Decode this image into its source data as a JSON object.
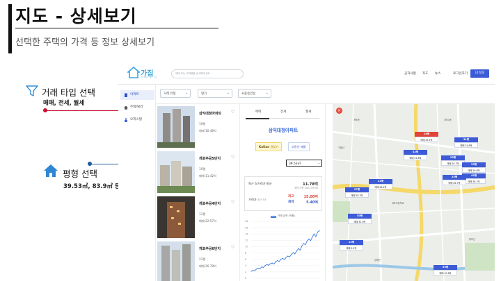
{
  "slide": {
    "title": "지도 - 상세보기",
    "subtitle": "선택한 주택의 가격 등 정보 상세보기"
  },
  "annotations": {
    "trade": {
      "label": "거래 타입 선택",
      "sub": "매매, 전세, 월세",
      "color": "#c8102e"
    },
    "area": {
      "label": "평형 선택",
      "sub": "39.53㎡, 83.9㎡ 등",
      "color": "#1f5c99"
    }
  },
  "app": {
    "logo": {
      "name": "가집",
      "tagline": "가 보고 사는 집"
    },
    "search_placeholder": "매매 또는 주택명을 검색해주세요",
    "nav": [
      "공지사항",
      "지도",
      "뉴스"
    ],
    "login": "로그인하기",
    "join": "내 정보"
  },
  "sidebar": {
    "items": [
      {
        "label": "아파트",
        "active": true
      },
      {
        "label": "주택/빌라",
        "active": false
      },
      {
        "label": "오피스텔",
        "active": false
      }
    ]
  },
  "filters": [
    {
      "label": "거래 유형"
    },
    {
      "label": "평가"
    },
    {
      "label": "사용승인일"
    }
  ],
  "listings": [
    {
      "name": "삼익대청아파트",
      "floor": "19평",
      "price": "매매 16.48억"
    },
    {
      "name": "개포주공5단지",
      "floor": "19평",
      "price": "매매 11.42억"
    },
    {
      "name": "개포주공4단지",
      "floor": "13평",
      "price": "매매 22.57억"
    },
    {
      "name": "개포주공6단지",
      "floor": "23평",
      "price": "매매 26.78억"
    }
  ],
  "detail": {
    "tabs": [
      "매매",
      "전세",
      "월세"
    ],
    "active_tab": "매매",
    "title": "삼익대청아파트",
    "kakao_btn": {
      "brand": "KaKao",
      "label": "길찾기"
    },
    "bds_btn": "부동산 매물",
    "area_select": "39.53㎡",
    "recent_label": "최근 실거래가 평균",
    "recent_value": "11.78억",
    "recent_date": "계약 기준 2021.09.30",
    "count_label": "거래가",
    "count_sub": "최근 3년",
    "high_label": "최고",
    "high_value": "15.00억",
    "low_label": "최저",
    "low_value": "5.40억",
    "chart_legend": "거래 금액 (억원)"
  },
  "chart_data": {
    "type": "line",
    "title": "",
    "legend": "거래 금액 (억원)",
    "xlabel": "",
    "ylabel": "",
    "yticks": [
      18,
      16,
      14,
      12,
      10,
      8,
      6,
      4,
      2,
      0
    ],
    "ylim": [
      0,
      18
    ],
    "grid": true,
    "series": [
      {
        "name": "거래 금액 (억원)",
        "values": [
          2.2,
          2.5,
          2.4,
          2.9,
          3.1,
          3.0,
          3.6,
          3.4,
          4.0,
          4.3,
          4.1,
          4.6,
          4.8,
          4.5,
          5.2,
          5.6,
          5.3,
          6.0,
          6.3,
          5.9,
          6.6,
          7.0,
          6.8,
          7.5,
          8.1,
          7.7,
          8.6,
          9.4,
          8.9,
          10.2,
          11.0,
          10.6,
          11.8,
          12.4,
          11.9,
          13.1,
          14.0,
          13.2,
          14.6,
          15.0
        ]
      }
    ]
  },
  "map": {
    "markers": [
      {
        "floor": "18평",
        "price": "매매 23.1억",
        "red": true
      },
      {
        "floor": "31평",
        "price": "매매 24.6억",
        "red": false
      },
      {
        "floor": "32평",
        "price": "매매 21.8억",
        "red": false
      },
      {
        "floor": "25평",
        "price": "매매 26.7억",
        "red": false
      },
      {
        "floor": "33평",
        "price": "매매 29.6억",
        "red": false
      },
      {
        "floor": "42평",
        "price": "매매 38.7억",
        "red": false
      },
      {
        "floor": "25평",
        "price": "매매 26.7억",
        "red": false
      },
      {
        "floor": "22평",
        "price": "매매 26.4억",
        "red": false
      },
      {
        "floor": "27평",
        "price": "매매 28.3억",
        "red": false
      },
      {
        "floor": "30평",
        "price": "매매 32.0억",
        "red": false
      },
      {
        "floor": "13평",
        "price": "매매 9.2억",
        "red": false
      },
      {
        "floor": "39평",
        "price": "매매 10.6억",
        "red": false
      }
    ],
    "labels": [
      "개포동",
      "개포초등학교",
      "양재천",
      "개포1동",
      "대모산",
      "구룡산"
    ],
    "colors": {
      "accent": "#3d5bd6",
      "red": "#e0443a"
    }
  }
}
